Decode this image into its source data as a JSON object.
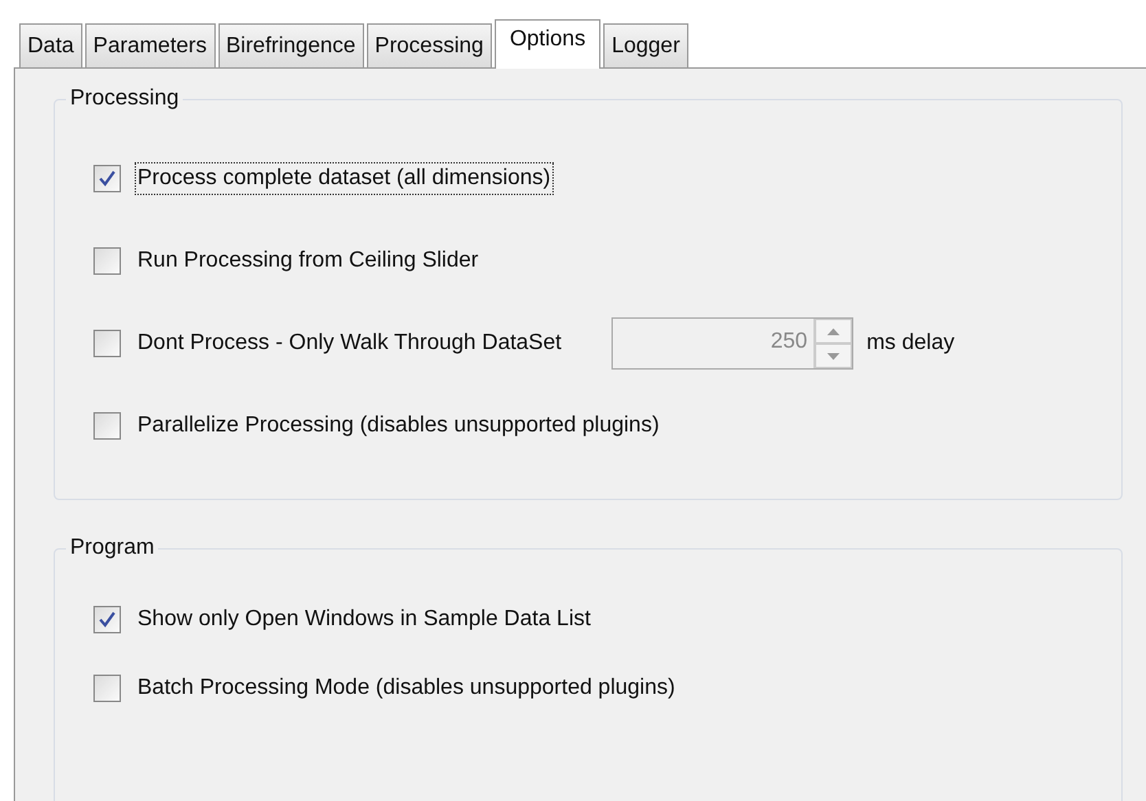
{
  "tabs": [
    {
      "label": "Data",
      "selected": false
    },
    {
      "label": "Parameters",
      "selected": false
    },
    {
      "label": "Birefringence",
      "selected": false
    },
    {
      "label": "Processing",
      "selected": false
    },
    {
      "label": "Options",
      "selected": true
    },
    {
      "label": "Logger",
      "selected": false
    }
  ],
  "groups": [
    {
      "title": "Processing",
      "items": [
        {
          "kind": "checkbox",
          "label": "Process complete dataset (all dimensions)",
          "checked": true,
          "focused": true
        },
        {
          "kind": "checkbox",
          "label": "Run Processing from Ceiling Slider",
          "checked": false,
          "focused": false
        },
        {
          "kind": "checkbox-spinner",
          "label": "Dont Process - Only Walk Through DataSet",
          "checked": false,
          "focused": false,
          "spinner": {
            "value": "250",
            "disabled": true,
            "unit": "ms delay"
          }
        },
        {
          "kind": "checkbox",
          "label": "Parallelize Processing (disables unsupported plugins)",
          "checked": false,
          "focused": false
        }
      ]
    },
    {
      "title": "Program",
      "items": [
        {
          "kind": "checkbox",
          "label": "Show only Open Windows in Sample Data List",
          "checked": true,
          "focused": false
        },
        {
          "kind": "checkbox",
          "label": "Batch Processing Mode (disables unsupported plugins)",
          "checked": false,
          "focused": false
        }
      ]
    }
  ]
}
